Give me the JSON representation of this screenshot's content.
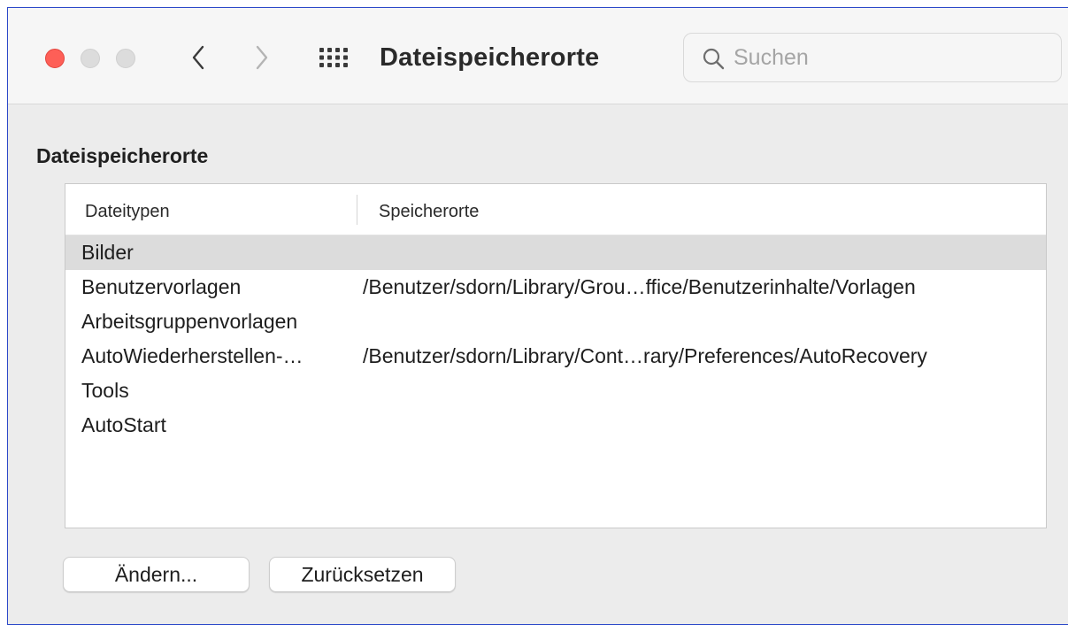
{
  "window": {
    "title": "Dateispeicherorte",
    "search": {
      "placeholder": "Suchen",
      "value": ""
    },
    "icons": [
      "close-button",
      "minimize-button",
      "zoom-button",
      "chevron-left-icon",
      "chevron-right-icon",
      "grid-icon",
      "search-icon"
    ],
    "colors": {
      "close": "#fe5f57",
      "selection": "#dcdcdc",
      "border": "#2c49c9"
    }
  },
  "section": {
    "title": "Dateispeicherorte"
  },
  "table": {
    "headers": {
      "type": "Dateitypen",
      "location": "Speicherorte"
    },
    "rows": [
      {
        "type": "Bilder",
        "location": "",
        "selected": true
      },
      {
        "type": "Benutzervorlagen",
        "location": "/Benutzer/sdorn/Library/Grou…ffice/Benutzerinhalte/Vorlagen",
        "selected": false
      },
      {
        "type": "Arbeitsgruppenvorlagen",
        "location": "",
        "selected": false
      },
      {
        "type": "AutoWiederherstellen-…",
        "location": "/Benutzer/sdorn/Library/Cont…rary/Preferences/AutoRecovery",
        "selected": false
      },
      {
        "type": "Tools",
        "location": "",
        "selected": false
      },
      {
        "type": "AutoStart",
        "location": "",
        "selected": false
      }
    ]
  },
  "buttons": {
    "change": "Ändern...",
    "reset": "Zurücksetzen"
  }
}
